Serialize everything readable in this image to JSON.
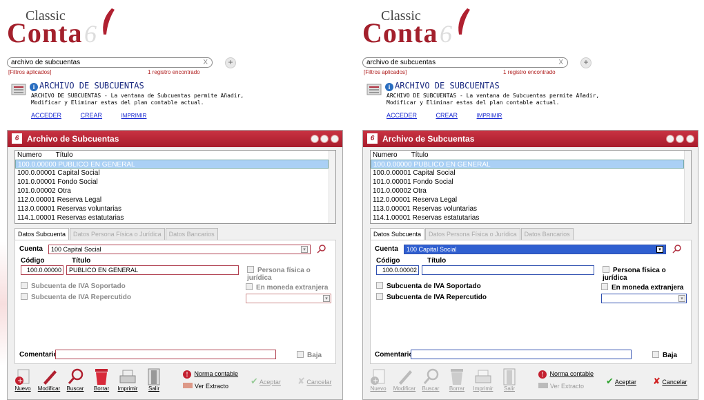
{
  "logo": {
    "classic": "Classic",
    "conta": "Conta",
    "six": "6"
  },
  "search": {
    "value": "archivo de subcuentas",
    "clear": "X",
    "add": "+"
  },
  "filters": "[Filtros aplicados]",
  "registros": "1 registro encontrado",
  "result": {
    "title": "ARCHIVO DE SUBCUENTAS",
    "desc_line1": "ARCHIVO DE SUBCUENTAS - La ventana de Subcuentas permite Añadir,",
    "desc_line2": "Modificar y Eliminar estas del plan contable actual.",
    "links": [
      "ACCEDER",
      "CREAR",
      "IMPRIMIR"
    ]
  },
  "window": {
    "title": "Archivo de Subcuentas",
    "app_icon": "6",
    "columns": [
      "Numero",
      "Título"
    ],
    "rows": [
      {
        "num": "100.0.00000",
        "title": "PUBLICO EN GENERAL"
      },
      {
        "num": "100.0.00001",
        "title": "Capital Social"
      },
      {
        "num": "101.0.00001",
        "title": "Fondo Social"
      },
      {
        "num": "101.0.00002",
        "title": "Otra"
      },
      {
        "num": "112.0.00001",
        "title": "Reserva Legal"
      },
      {
        "num": "113.0.00001",
        "title": "Reservas voluntarias"
      },
      {
        "num": "114.1.00001",
        "title": "Reservas estatutarias"
      }
    ],
    "tabs": [
      "Datos Subcuenta",
      "Datos Persona Física o Jurídica",
      "Datos Bancarios"
    ],
    "labels": {
      "cuenta": "Cuenta",
      "codigo": "Código",
      "titulo": "Título",
      "persona": "Persona física o jurídica",
      "iva_sop": "Subcuenta de IVA Soportado",
      "iva_rep": "Subcuenta de IVA Repercutido",
      "moneda": "En moneda extranjera",
      "comentario": "Comentario",
      "baja": "Baja"
    },
    "toolbar": [
      "Nuevo",
      "Modificar",
      "Buscar",
      "Borrar",
      "Imprimir",
      "Salir"
    ],
    "norma": "Norma contable",
    "extracto": "Ver Extracto",
    "aceptar": "Aceptar",
    "cancelar": "Cancelar"
  },
  "left_form": {
    "cuenta": "100   Capital Social",
    "codigo": "100.0.00000",
    "titulo": "PUBLICO EN GENERAL"
  },
  "right_form": {
    "cuenta": "100   Capital Social",
    "codigo": "100.0.00002",
    "titulo": ""
  },
  "colors": {
    "brand": "#a81c2c",
    "link": "#1a2ad0",
    "selection": "#aad0f5"
  }
}
